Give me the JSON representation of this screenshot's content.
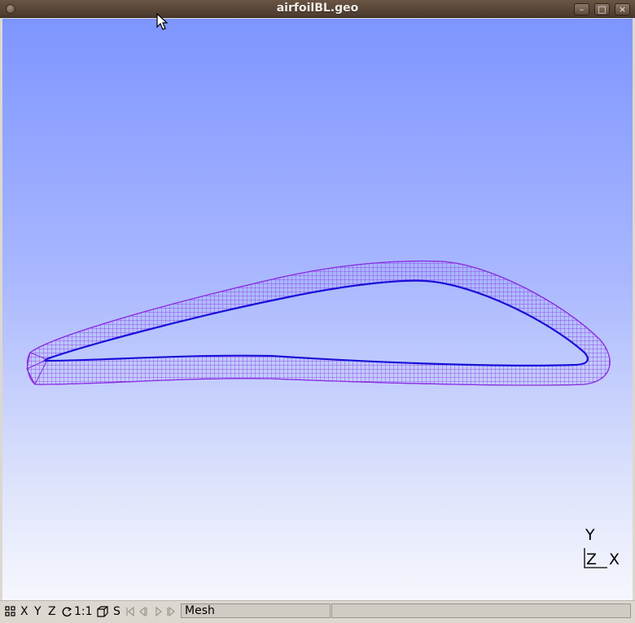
{
  "window": {
    "title": "airfoilBL.geo"
  },
  "viewport": {
    "axes": {
      "y": "Y",
      "z": "Z",
      "x": "X"
    }
  },
  "statusbar": {
    "buttons": {
      "x": "X",
      "y": "Y",
      "z": "Z",
      "scale": "1:1",
      "s": "S"
    },
    "icons": [
      "grid-icon",
      "rotate-icon",
      "cube-icon",
      "first-icon",
      "prev-icon",
      "play-icon",
      "next-icon"
    ],
    "message": "Mesh",
    "message2": ""
  },
  "colors": {
    "mesh": "#8a2be2",
    "mesh_edge": "#1a10d8",
    "bg_top": "#7e95ff",
    "bg_bottom": "#f6f7fd"
  }
}
